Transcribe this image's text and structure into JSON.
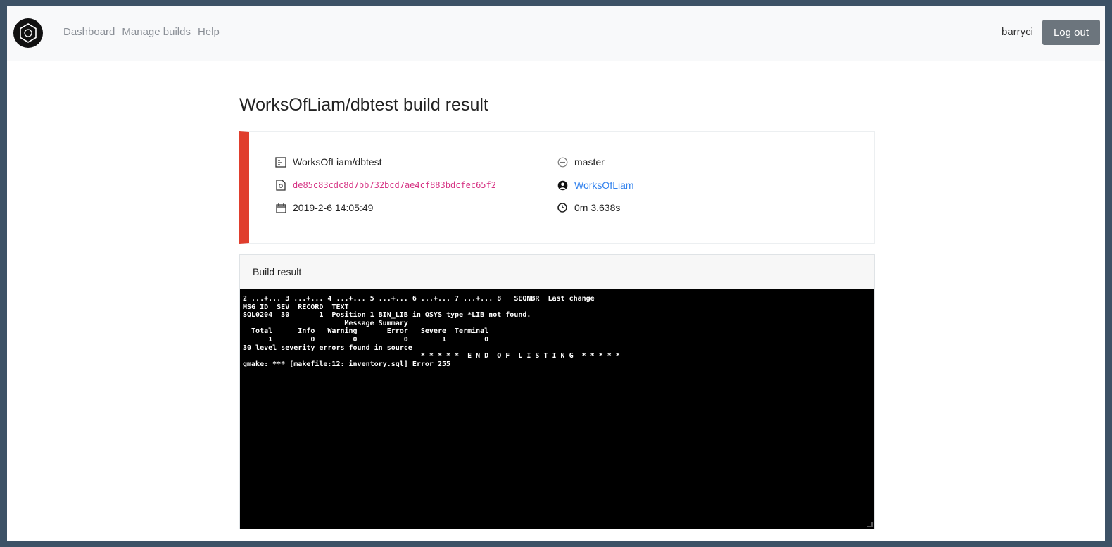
{
  "nav": {
    "links": [
      "Dashboard",
      "Manage builds",
      "Help"
    ],
    "username": "barryci",
    "logout_label": "Log out"
  },
  "page": {
    "title": "WorksOfLiam/dbtest build result"
  },
  "build": {
    "repo": "WorksOfLiam/dbtest",
    "commit": "de85c83cdc8d7bb732bcd7ae4cf883bdcfec65f2",
    "date": "2019-2-6 14:05:49",
    "branch": "master",
    "author": "WorksOfLiam",
    "duration": "0m 3.638s",
    "status_color": "#e03e2d"
  },
  "result": {
    "header": "Build result",
    "output_lines": [
      "2 ...+... 3 ...+... 4 ...+... 5 ...+... 6 ...+... 7 ...+... 8   SEQNBR  Last change",
      "MSG ID  SEV  RECORD  TEXT",
      "SQL0204  30       1  Position 1 BIN_LIB in QSYS type *LIB not found.",
      "                        Message Summary",
      "  Total      Info   Warning       Error   Severe  Terminal",
      "      1         0         0           0        1         0",
      "30 level severity errors found in source",
      "                                          * * * * *  E N D  O F  L I S T I N G  * * * * *",
      "gmake: *** [makefile:12: inventory.sql] Error 255"
    ]
  }
}
